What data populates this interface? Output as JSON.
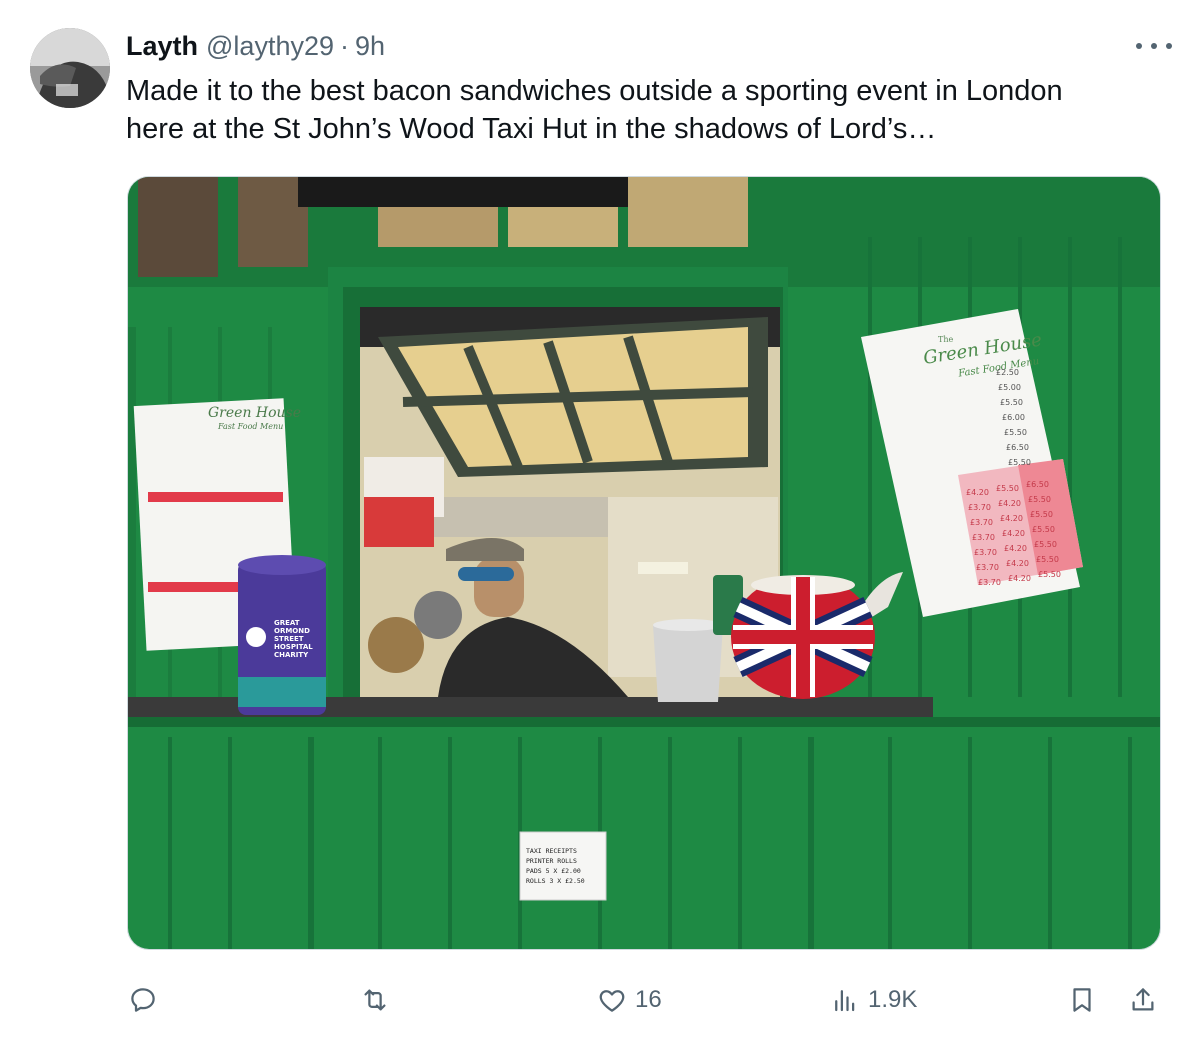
{
  "tweet": {
    "author_name": "Layth",
    "author_handle": "@laythy29",
    "separator": "·",
    "time": "9h",
    "text_line1": "Made it to the best bacon sandwiches outside a sporting event in London",
    "text_line2": "here at the St John’s Wood Taxi Hut in the shadows of Lord’s…"
  },
  "photo": {
    "menu_title": "Green House",
    "menu_the": "The",
    "menu_subtitle": "Fast Food Menu",
    "left_menu_title": "Green House",
    "left_menu_subtitle": "Fast Food Menu",
    "charity_line1": "GREAT",
    "charity_line2": "ORMOND",
    "charity_line3": "STREET",
    "charity_line4": "HOSPITAL",
    "charity_line5": "CHARITY",
    "sign_line1": "TAXI RECEIPTS",
    "sign_line2": "PRINTER ROLLS",
    "sign_line3": "PADS 5 X £2.00",
    "sign_line4": "ROLLS 3 X £2.50",
    "prices_col1": [
      "£4.20",
      "£3.70",
      "£3.70",
      "£3.70",
      "£3.70",
      "£3.70",
      "£3.70"
    ],
    "prices_col2": [
      "£5.50",
      "£4.20",
      "£4.20",
      "£4.20",
      "£4.20",
      "£4.20",
      "£4.20"
    ],
    "prices_col3": [
      "£6.50",
      "£5.50",
      "£5.50",
      "£5.50",
      "£5.50",
      "£5.50",
      "£5.50"
    ],
    "prices_top": [
      "£2.50",
      "£5.00",
      "£5.50",
      "£6.00",
      "£5.50",
      "£6.50",
      "£5.50"
    ]
  },
  "actions": {
    "reply_icon": "reply-icon",
    "repost_icon": "repost-icon",
    "like_icon": "heart-icon",
    "like_count": "16",
    "views_icon": "views-icon",
    "views_count": "1.9K",
    "bookmark_icon": "bookmark-icon",
    "share_icon": "share-icon"
  },
  "colors": {
    "text_primary": "#0f1419",
    "text_secondary": "#536471",
    "hut_green": "#1f8a45"
  }
}
